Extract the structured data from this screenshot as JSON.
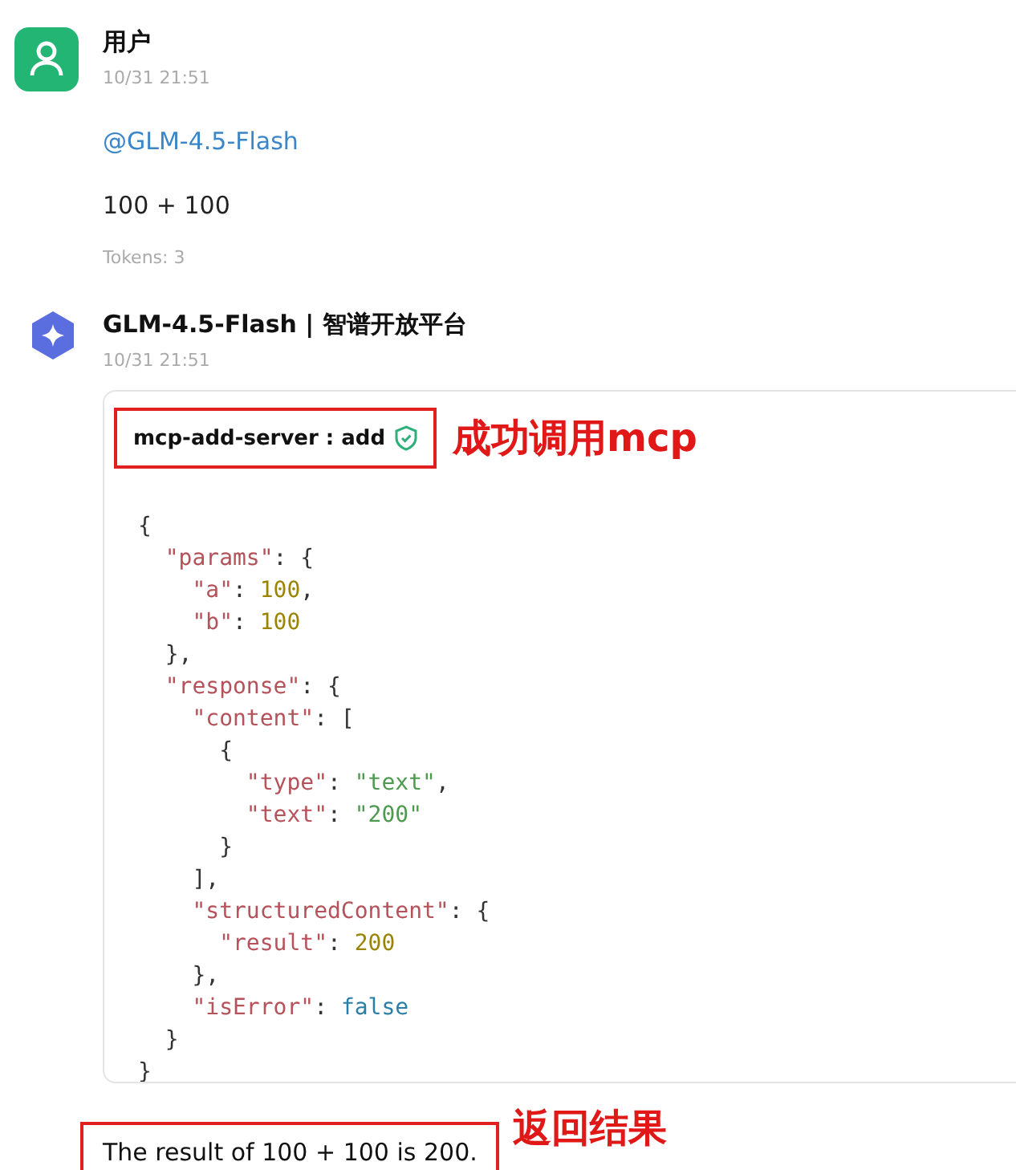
{
  "messages": [
    {
      "kind": "user",
      "author": "用户",
      "time": "10/31 21:51",
      "mention": "@GLM-4.5-Flash",
      "text": "100 + 100",
      "tokens": "Tokens: 3"
    },
    {
      "kind": "bot",
      "author": "GLM-4.5-Flash | 智谱开放平台",
      "time": "10/31 21:51",
      "tool_call": {
        "title": "mcp-add-server : add",
        "annotation": "成功调用mcp",
        "code_lines": [
          [
            {
              "kind": "punct",
              "text": "{"
            }
          ],
          [
            {
              "kind": "key",
              "text": "  \"params\""
            },
            {
              "kind": "punct",
              "text": ": {"
            }
          ],
          [
            {
              "kind": "key",
              "text": "    \"a\""
            },
            {
              "kind": "punct",
              "text": ": "
            },
            {
              "kind": "number",
              "text": "100"
            },
            {
              "kind": "punct",
              "text": ","
            }
          ],
          [
            {
              "kind": "key",
              "text": "    \"b\""
            },
            {
              "kind": "punct",
              "text": ": "
            },
            {
              "kind": "number",
              "text": "100"
            }
          ],
          [
            {
              "kind": "punct",
              "text": "  },"
            }
          ],
          [
            {
              "kind": "key",
              "text": "  \"response\""
            },
            {
              "kind": "punct",
              "text": ": {"
            }
          ],
          [
            {
              "kind": "key",
              "text": "    \"content\""
            },
            {
              "kind": "punct",
              "text": ": ["
            }
          ],
          [
            {
              "kind": "punct",
              "text": "      {"
            }
          ],
          [
            {
              "kind": "key",
              "text": "        \"type\""
            },
            {
              "kind": "punct",
              "text": ": "
            },
            {
              "kind": "string",
              "text": "\"text\""
            },
            {
              "kind": "punct",
              "text": ","
            }
          ],
          [
            {
              "kind": "key",
              "text": "        \"text\""
            },
            {
              "kind": "punct",
              "text": ": "
            },
            {
              "kind": "string",
              "text": "\"200\""
            }
          ],
          [
            {
              "kind": "punct",
              "text": "      }"
            }
          ],
          [
            {
              "kind": "punct",
              "text": "    ],"
            }
          ],
          [
            {
              "kind": "key",
              "text": "    \"structuredContent\""
            },
            {
              "kind": "punct",
              "text": ": {"
            }
          ],
          [
            {
              "kind": "key",
              "text": "      \"result\""
            },
            {
              "kind": "punct",
              "text": ": "
            },
            {
              "kind": "number",
              "text": "200"
            }
          ],
          [
            {
              "kind": "punct",
              "text": "    },"
            }
          ],
          [
            {
              "kind": "key",
              "text": "    \"isError\""
            },
            {
              "kind": "punct",
              "text": ": "
            },
            {
              "kind": "boolean",
              "text": "false"
            }
          ],
          [
            {
              "kind": "punct",
              "text": "  }"
            }
          ],
          [
            {
              "kind": "punct",
              "text": "}"
            }
          ]
        ]
      },
      "result": "The result of 100 + 100 is 200.",
      "result_annotation": "返回结果"
    }
  ]
}
